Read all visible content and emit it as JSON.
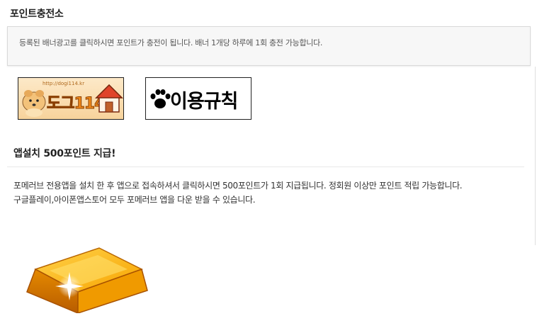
{
  "page": {
    "title": "포인트충전소"
  },
  "notice": {
    "text": "등록된 배너광고를 클릭하시면 포인트가 충전이 됩니다. 배너 1개당 하루에 1회 충전 가능합니다."
  },
  "banners": [
    {
      "name": "dogi114",
      "url_text": "http://dogi114.kr",
      "logo_text": "도그114"
    },
    {
      "name": "rules",
      "text": "이용규칙",
      "icon": "paw-icon"
    }
  ],
  "app_section": {
    "title": "앱설치 500포인트 지급!",
    "lines": [
      "포메러브 전용앱을 설치 한 후 앱으로 접속하셔서 클릭하시면 500포인트가 1회 지급됩니다. 정회원 이상만 포인트 적립 가능합니다.",
      "구글플레이,아이폰앱스토어 모두 포메러브 앱을 다운 받을 수 있습니다."
    ],
    "image_icon": "gold-bar-icon"
  },
  "colors": {
    "gold": "#f5a500",
    "notice_bg": "#f7f7f7",
    "border": "#d9d9d9"
  }
}
